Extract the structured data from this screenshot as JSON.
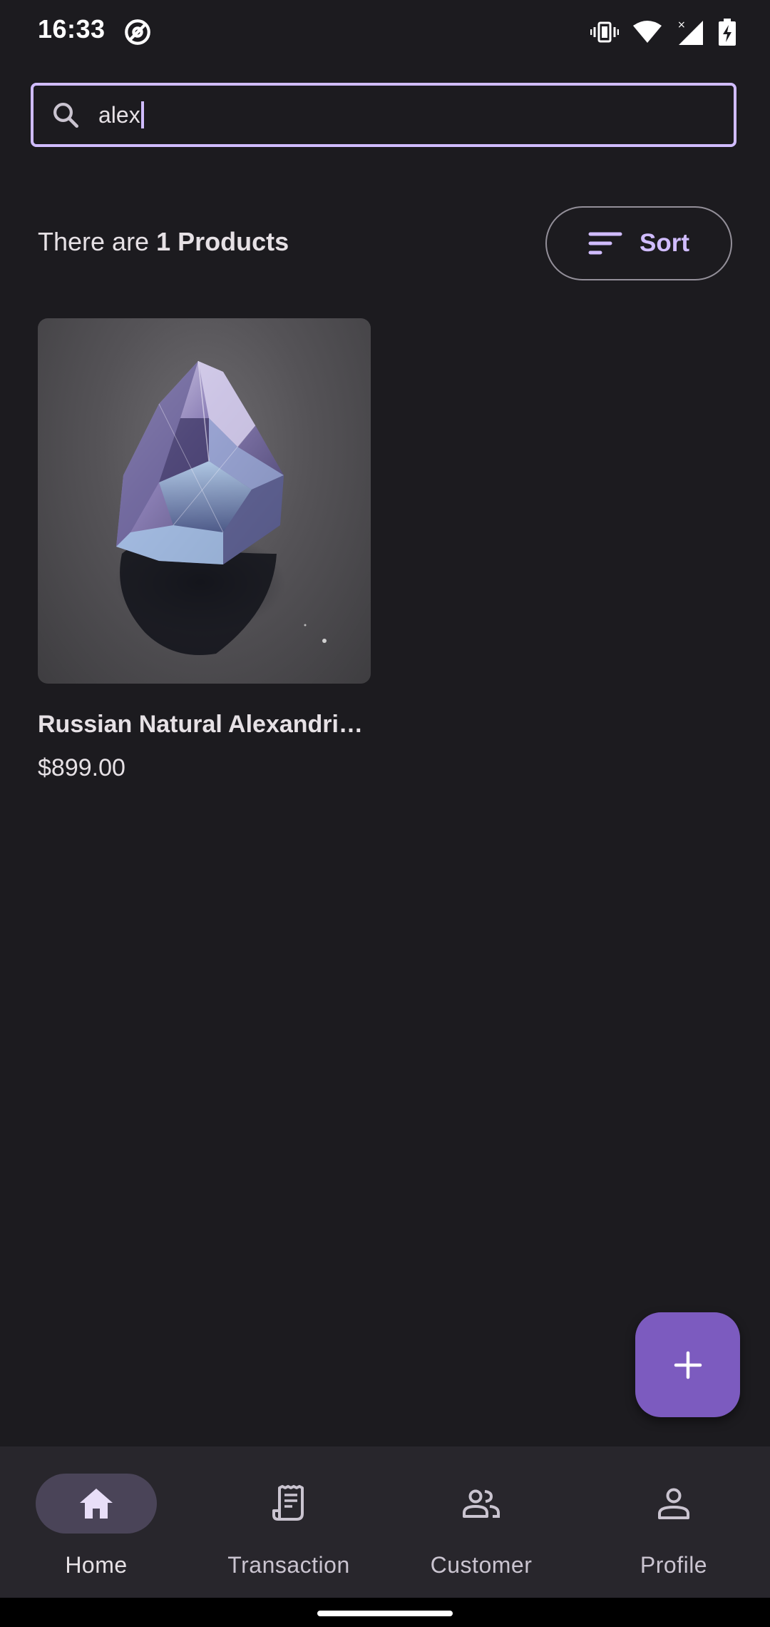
{
  "status_bar": {
    "time": "16:33",
    "icons": [
      "at-sign-icon",
      "vibrate-icon",
      "wifi-icon",
      "cellular-signal-icon",
      "battery-charging-icon"
    ]
  },
  "search": {
    "value": "alex",
    "icon": "search-icon"
  },
  "summary": {
    "prefix": "There are ",
    "count_text": "1 Products"
  },
  "sort_button": {
    "label": "Sort",
    "icon": "sort-icon"
  },
  "products": [
    {
      "name": "Russian Natural Alexandri…",
      "price": "$899.00"
    }
  ],
  "fab": {
    "icon": "plus-icon"
  },
  "bottom_nav": {
    "items": [
      {
        "label": "Home",
        "icon": "home-icon",
        "active": true
      },
      {
        "label": "Transaction",
        "icon": "receipt-icon",
        "active": false
      },
      {
        "label": "Customer",
        "icon": "people-icon",
        "active": false
      },
      {
        "label": "Profile",
        "icon": "person-icon",
        "active": false
      }
    ]
  },
  "colors": {
    "background": "#1c1b1f",
    "accent": "#d0bcff",
    "fab": "#7c5bbf",
    "nav_background": "#28262c",
    "nav_active_pill": "#4a4458"
  }
}
